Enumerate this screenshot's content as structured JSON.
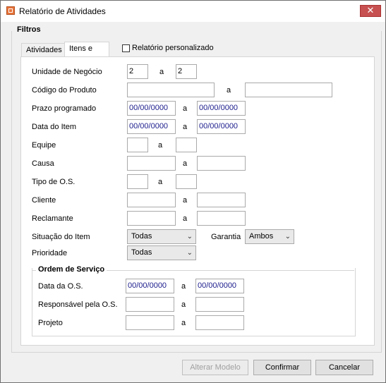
{
  "window": {
    "title": "Relatório de Atividades",
    "close_glyph": "✕"
  },
  "filters": {
    "label": "Filtros"
  },
  "tabs": [
    {
      "label": "Atividades"
    },
    {
      "label": "Itens e OS"
    }
  ],
  "custom_report": {
    "label": "Relatório personalizado",
    "checked": false
  },
  "separator": "a",
  "fields": {
    "unidade": {
      "label": "Unidade de Negócio",
      "from": "2",
      "to": "2"
    },
    "codigo": {
      "label": "Código do Produto",
      "from": "",
      "to": ""
    },
    "prazo": {
      "label": "Prazo programado",
      "from": "00/00/0000",
      "to": "00/00/0000"
    },
    "data_item": {
      "label": "Data do Item",
      "from": "00/00/0000",
      "to": "00/00/0000"
    },
    "equipe": {
      "label": "Equipe",
      "from": "",
      "to": ""
    },
    "causa": {
      "label": "Causa",
      "from": "",
      "to": ""
    },
    "tipo_os": {
      "label": "Tipo de O.S.",
      "from": "",
      "to": ""
    },
    "cliente": {
      "label": "Cliente",
      "from": "",
      "to": ""
    },
    "reclamante": {
      "label": "Reclamante",
      "from": "",
      "to": ""
    },
    "situacao": {
      "label": "Situação do Item",
      "value": "Todas"
    },
    "garantia": {
      "label": "Garantia",
      "value": "Ambos"
    },
    "prioridade": {
      "label": "Prioridade",
      "value": "Todas"
    }
  },
  "ordem_servico": {
    "label": "Ordem de Serviço",
    "data_os": {
      "label": "Data da O.S.",
      "from": "00/00/0000",
      "to": "00/00/0000"
    },
    "responsavel": {
      "label": "Responsável pela O.S.",
      "from": "",
      "to": ""
    },
    "projeto": {
      "label": "Projeto",
      "from": "",
      "to": ""
    }
  },
  "buttons": {
    "alterar_modelo": {
      "label": "Alterar Modelo",
      "enabled": false
    },
    "confirmar": {
      "label": "Confirmar"
    },
    "cancelar": {
      "label": "Cancelar"
    }
  },
  "icons": {
    "app": "report-app-icon",
    "close": "close-icon",
    "chevron": "chevron-down-icon"
  },
  "colors": {
    "date_text": "#1a1a8c",
    "close_button": "#c75050"
  }
}
